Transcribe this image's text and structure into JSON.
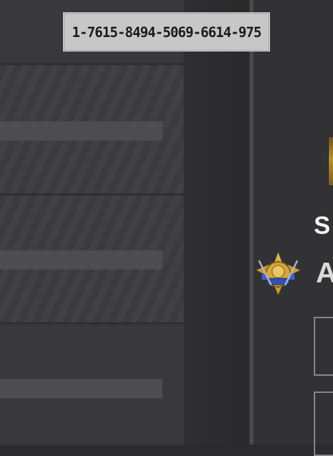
{
  "player": {
    "id": "1-7615-8494-5069-6614-975",
    "name_visible": "S",
    "rank_visible": "A"
  },
  "inventory": {
    "slots": 3
  },
  "icons": {
    "rank_emblem": "ace-rank-emblem-icon"
  },
  "colors": {
    "background": "#2b2b2d",
    "id_badge": "#c7c7c7",
    "accent_gold": "#b8902a",
    "emblem_blue": "#2f52b8"
  }
}
